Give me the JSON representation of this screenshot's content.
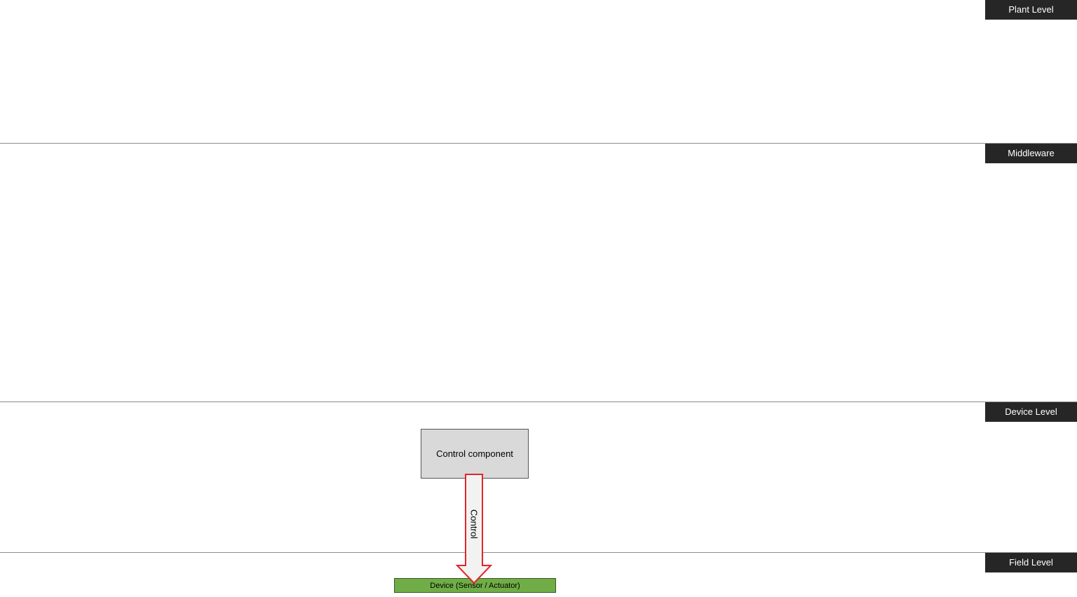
{
  "levels": {
    "plant": "Plant Level",
    "middleware": "Middleware",
    "device": "Device Level",
    "field": "Field Level"
  },
  "components": {
    "control": "Control component",
    "device": "Device (Sensor / Actuator)"
  },
  "connections": {
    "control_arrow": "Control"
  },
  "colors": {
    "tag_background": "#262626",
    "control_fill": "#d9d9d9",
    "device_fill": "#70ad47",
    "arrow_stroke": "#e0262b",
    "arrow_fill": "#f2f2f2"
  }
}
